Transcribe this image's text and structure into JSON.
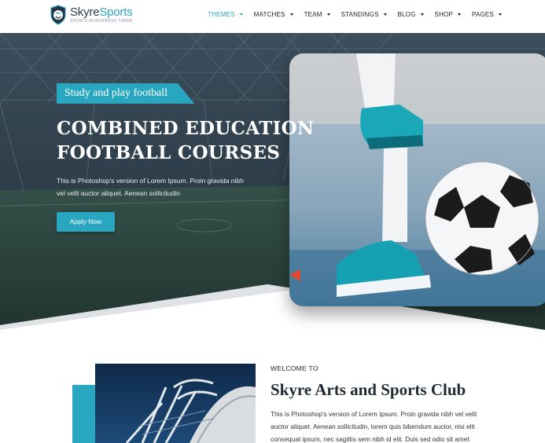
{
  "brand": {
    "name_part1": "Skyre",
    "name_part2": "Sports",
    "tagline": "SPORTS WORDPRESS THEME",
    "accent": "#2aa7c0"
  },
  "nav": [
    {
      "label": "THEMES",
      "active": true
    },
    {
      "label": "MATCHES"
    },
    {
      "label": "TEAM"
    },
    {
      "label": "STANDINGS"
    },
    {
      "label": "BLOG"
    },
    {
      "label": "SHOP"
    },
    {
      "label": "PAGES"
    }
  ],
  "hero": {
    "tag": "Study and play football",
    "title_line1": "COMBINED EDUCATION",
    "title_line2": "FOOTBALL COURSES",
    "text_line1": "This is Photoshop's version of Lorem Ipsum. Proin gravida nibh",
    "text_line2": "vel velit auctor aliquet. Aenean sollicitudin",
    "button": "Apply Now"
  },
  "about": {
    "kicker": "WELCOME TO",
    "title": "Skyre Arts and Sports Club",
    "text_line1": "This is Photoshop's version of Lorem Ipsum. Proin gravida nibh vel velit",
    "text_line2": "auctor aliquet. Aenean sollicitudin, lorem quis bibendum auctor, nisi elit",
    "text_line3": "consequat ipsum, nec sagittis sem nibh id elit. Duis sed odio sit amet"
  }
}
